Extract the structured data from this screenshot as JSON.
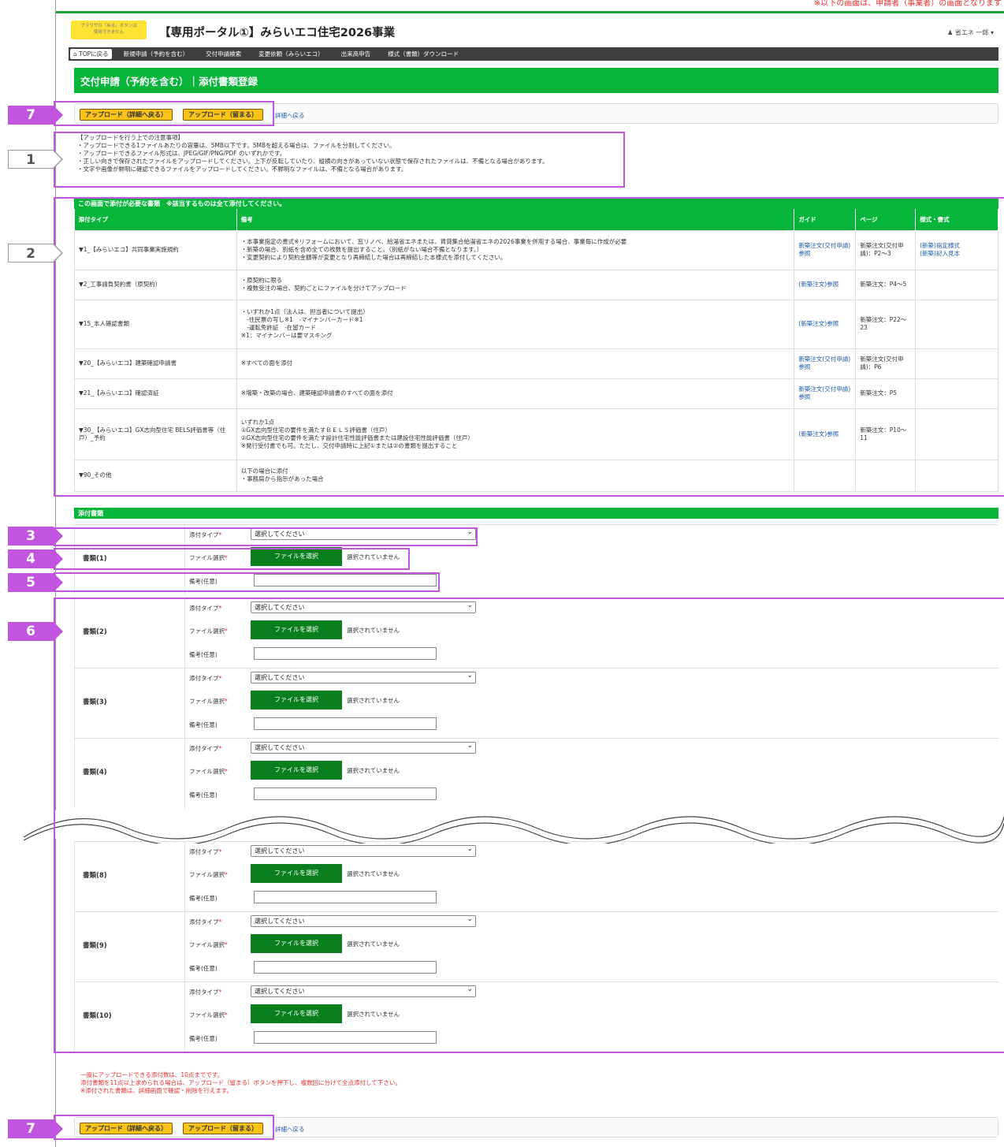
{
  "header": {
    "top_red_text": "※以下の画面は、申請者（事業者）の画面となります",
    "logo_line1": "ブラウザの「戻る」ボタンは",
    "logo_line2": "使用できません",
    "title": "【専用ポータル①】みらいエコ住宅2026事業",
    "user": "♟ 省エネ 一郎 ▾"
  },
  "nav": {
    "home": "TOPに戻る",
    "items": [
      "新規申請（予約を含む）",
      "交付申請検索",
      "変更依頼（みらいエコ）",
      "出来高申告",
      "様式（書類）ダウンロード"
    ]
  },
  "page_title": "交付申請（予約を含む）｜添付書類登録",
  "toolbar": {
    "btn_upload_back": "アップロード（詳細へ戻る）",
    "btn_upload_stay": "アップロード（留まる）",
    "link_back": "詳細へ戻る"
  },
  "notes": [
    "【アップロードを行う上での注意事項】",
    "・アップロードできる1ファイルあたりの容量は、5MB以下です。5MBを超える場合は、ファイルを分割してください。",
    "・アップロードできるファイル形式は、JPEG/GIF/PNG/PDF のいずれかです。",
    "・正しい向きで保存されたファイルをアップロードしてください。上下が反転していたり、縦横の向きがあっていない状態で保存されたファイルは、不備となる場合があります。",
    "・文字や画像が鮮明に確認できるファイルをアップロードしてください。不鮮明なファイルは、不備となる場合があります。"
  ],
  "req_table": {
    "heading": "この画面で添付が必要な書類　※該当するものは全て添付してください。",
    "columns": [
      "添付タイプ",
      "備考",
      "ガイド",
      "ページ",
      "様式・書式"
    ],
    "rows": [
      {
        "type": "▼1_【みらいエコ】共同事業実施規約",
        "remarks": [
          "・本事業指定の書式※リフォームにおいて、窓リノベ、給湯省エネまたは、賃貸集合給湯省エネの2026事業を併用する場合、事業毎に作成が必要",
          "・新築の場合、別紙を含め全ての枚数を提出すること。（別紙がない場合不備となります。）",
          "・変更契約により契約金額等が変更となり再締結した場合は再締結した本様式を添付してください。"
        ],
        "guide": "新築注文(交付申請) 参照",
        "page": "新築注文(交付申請)：P2～3",
        "form": "(新築)指定様式\n(新築)記入見本"
      },
      {
        "type": "▼2_工事請負契約書（原契約）",
        "remarks": [
          "・原契約に限る",
          "・複数受注の場合、契約ごとにファイルを分けてアップロード"
        ],
        "guide": "(新築注文)参照",
        "page": "新築注文：P4～5",
        "form": ""
      },
      {
        "type": "▼15_本人確認書類",
        "remarks": [
          "・いずれか1点（法人は、担当者について提出）",
          "　-住民票の写し※1　-マイナンバーカード※1",
          "　-運転免許証　-在留カード",
          "※1：マイナンバーは要マスキング"
        ],
        "guide": "(新築注文)参照",
        "page": "新築注文：P22～23",
        "form": ""
      },
      {
        "type": "▼20_【みらいエコ】建築確認申請書",
        "remarks": [
          "※すべての面を添付"
        ],
        "guide": "新築注文(交付申請) 参照",
        "page": "新築注文(交付申請)：P6",
        "form": ""
      },
      {
        "type": "▼21_【みらいエコ】確認済証",
        "remarks": [
          "※増築・改築の場合、建築確認申請書のすべての面を添付"
        ],
        "guide": "新築注文(交付申請) 参照",
        "page": "新築注文：P5",
        "form": ""
      },
      {
        "type": "▼30_【みらいエコ】GX志向型住宅 BELS評価書等（住戸）_予約",
        "remarks": [
          "いずれか1点",
          "①GX志向型住宅の要件を満たすＢＥＬＳ評価書（住戸）",
          "②GX志向型住宅の要件を満たす設計住宅性能評価書または建設住宅性能評価書（住戸）",
          "※発行受付書でも可。ただし、交付申請時に上記①または②の書類を提出すること"
        ],
        "guide": "(新築注文)参照",
        "page": "新築注文：P10～11",
        "form": ""
      },
      {
        "type": "▼90_その他",
        "remarks": [
          "以下の場合に添付",
          "・事務局から指示があった場合"
        ],
        "guide": "",
        "page": "",
        "form": ""
      }
    ]
  },
  "attach": {
    "heading": "添付書類",
    "type_label": "添付タイプ",
    "file_label": "ファイル選択",
    "memo_label": "備考(任意)",
    "required_mark": "*",
    "select_placeholder": "選択してください",
    "file_button": "ファイルを選択",
    "file_status": "選択されていません",
    "docs": [
      "書類(1)",
      "書類(2)",
      "書類(3)",
      "書類(4)",
      "書類(8)",
      "書類(9)",
      "書類(10)"
    ]
  },
  "footnote": [
    "一度にアップロードできる添付数は、10点までです。",
    "添付書類を11点以上求められる場合は、アップロード（留まる）ボタンを押下し、複数回に分けて全点添付して下さい。",
    "※添付された書類は、詳細画面で確認・削除を行えます。"
  ],
  "callouts": [
    "7",
    "1",
    "2",
    "3",
    "4",
    "5",
    "6",
    "7"
  ],
  "colors": {
    "accent_green": "#06b53a",
    "file_button_green": "#0a7f1e",
    "upload_yellow": "#f8c219",
    "callout_purple": "#c155e0",
    "warning_red": "#e53030"
  }
}
